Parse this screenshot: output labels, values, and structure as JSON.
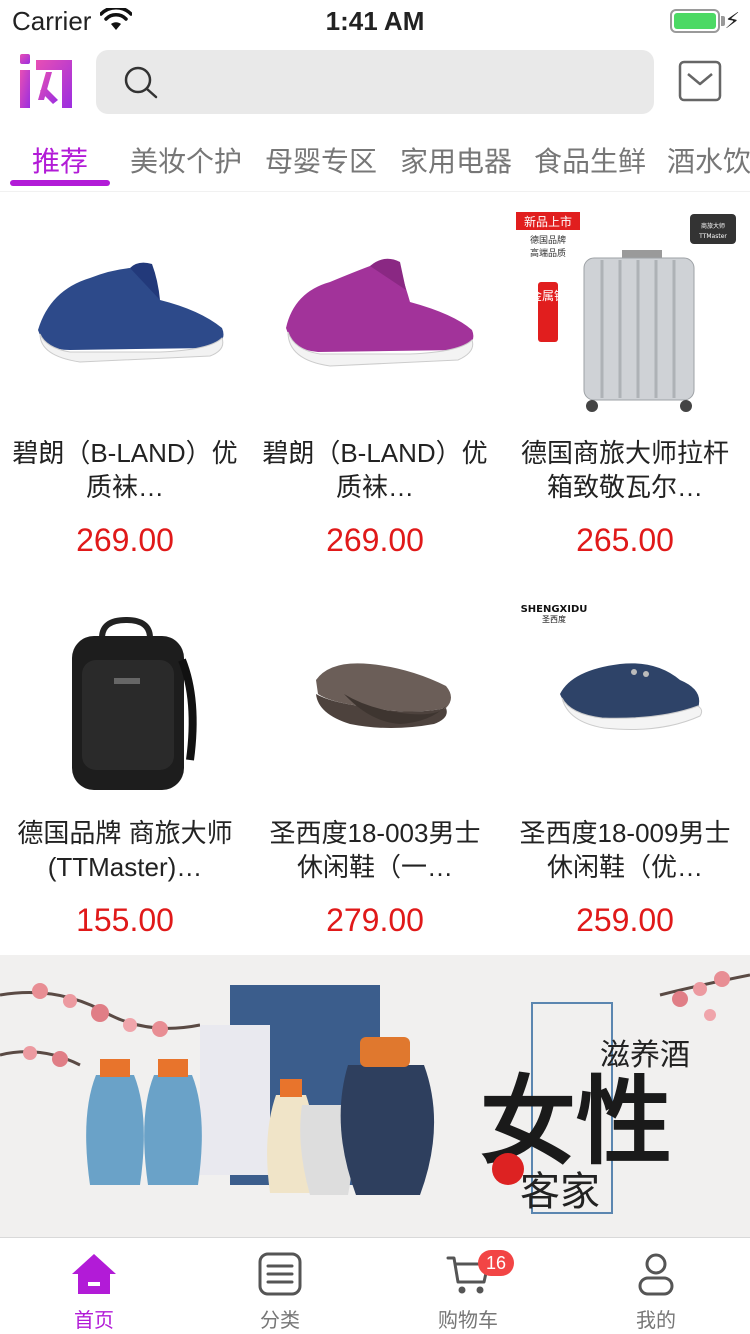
{
  "status_bar": {
    "carrier": "Carrier",
    "time": "1:41 AM",
    "battery_level": 1.0
  },
  "header": {
    "search_placeholder": ""
  },
  "tabs": [
    {
      "label": "推荐",
      "active": true
    },
    {
      "label": "美妆个护",
      "active": false
    },
    {
      "label": "母婴专区",
      "active": false
    },
    {
      "label": "家用电器",
      "active": false
    },
    {
      "label": "食品生鲜",
      "active": false
    },
    {
      "label": "酒水饮",
      "active": false
    }
  ],
  "products": [
    {
      "name": "碧朗（B-LAND）优质袜…",
      "price": "269.00",
      "image": "blue-sock-shoe"
    },
    {
      "name": "碧朗（B-LAND）优质袜…",
      "price": "269.00",
      "image": "purple-sock-shoe"
    },
    {
      "name": "德国商旅大师拉杆箱致敬瓦尔…",
      "price": "265.00",
      "image": "silver-suitcase",
      "image_texts": [
        "新品上市",
        "德国品牌",
        "高端品质",
        "金属银",
        "商旅大师",
        "TTMaster"
      ]
    },
    {
      "name": "德国品牌 商旅大师(TTMaster)…",
      "price": "155.00",
      "image": "black-backpack"
    },
    {
      "name": "圣西度18-003男士休闲鞋（一…",
      "price": "279.00",
      "image": "brown-loafer"
    },
    {
      "name": "圣西度18-009男士休闲鞋（优…",
      "price": "259.00",
      "image": "navy-sneaker",
      "image_texts": [
        "SHENGXIDU",
        "圣西度"
      ]
    }
  ],
  "banner": {
    "title": "女性",
    "subtitle": "滋养酒",
    "brand": "客家",
    "image": "womens-nourishing-wine-banner"
  },
  "tabbar": [
    {
      "label": "首页",
      "icon": "home-icon",
      "active": true
    },
    {
      "label": "分类",
      "icon": "list-icon",
      "active": false
    },
    {
      "label": "购物车",
      "icon": "cart-icon",
      "active": false,
      "badge": "16"
    },
    {
      "label": "我的",
      "icon": "user-icon",
      "active": false
    }
  ],
  "colors": {
    "accent": "#b21bd7",
    "price": "#e01919",
    "badge": "#f24545"
  }
}
